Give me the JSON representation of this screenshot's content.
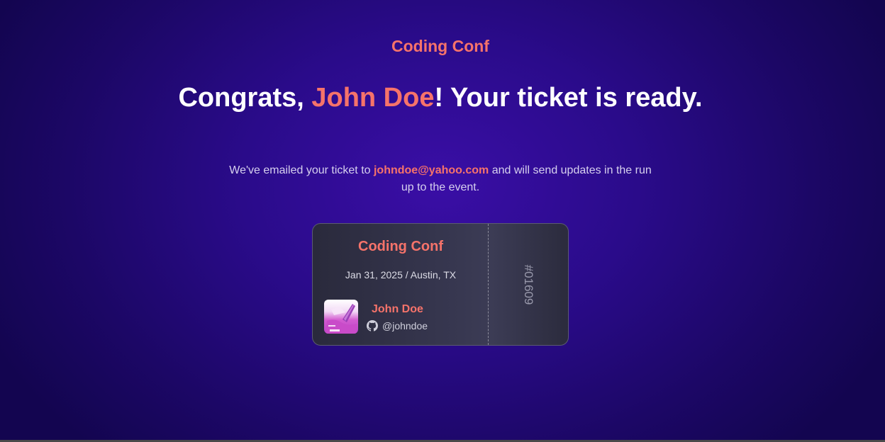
{
  "brand": {
    "name": "Coding Conf"
  },
  "headline": {
    "prefix": "Congrats, ",
    "name": "John Doe",
    "suffix": "! Your ticket is ready."
  },
  "message": {
    "prefix": "We've emailed your ticket to ",
    "email": "johndoe@yahoo.com",
    "suffix": " and will send updates in the run up to the event."
  },
  "ticket": {
    "event_name": "Coding Conf",
    "date_location": "Jan 31, 2025 / Austin, TX",
    "attendee_name": "John Doe",
    "github_handle": "@johndoe",
    "number": "#01609",
    "avatar_icon": "avatar-image",
    "github_icon": "github-icon"
  },
  "colors": {
    "accent": "#f6736a",
    "background": "#2a0b8a",
    "ticket_bg": "#373750"
  }
}
